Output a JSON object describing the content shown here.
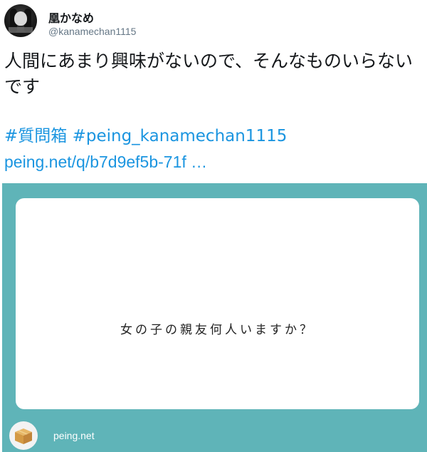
{
  "tweet": {
    "display_name": "凰かなめ",
    "handle": "@kanamechan1115",
    "text": "人間にあまり興味がないので、そんなものいらないです",
    "hashtag_1": "#質問箱",
    "hashtag_2": "#peing_kanamechan1115",
    "link": "peing.net/q/b7d9ef5b-71f …"
  },
  "card": {
    "question": "女の子の親友何人いますか？",
    "site": "peing.net",
    "icon": "cardboard-box-icon",
    "background_color": "#5fb4b8"
  },
  "colors": {
    "link": "#1b95e0",
    "handle": "#657786",
    "text": "#14171a"
  }
}
